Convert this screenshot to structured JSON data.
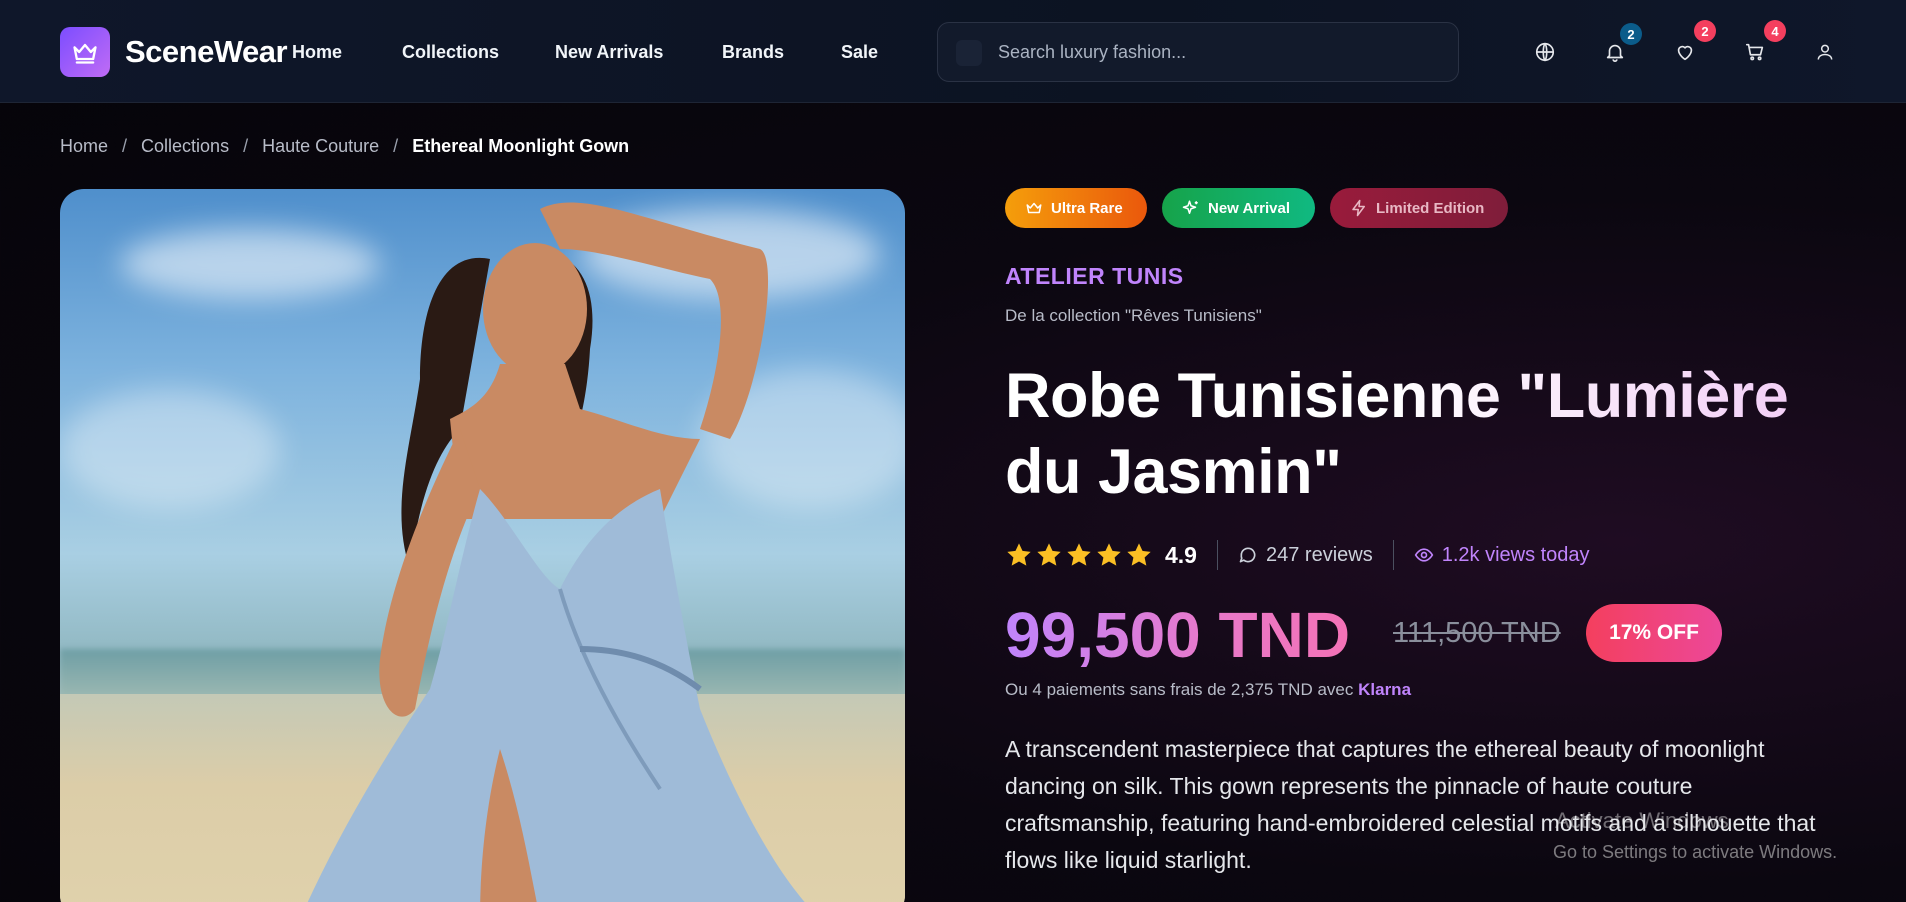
{
  "header": {
    "logo_text": "SceneWear",
    "nav": [
      "Home",
      "Collections",
      "New Arrivals",
      "Brands",
      "Sale"
    ],
    "search_placeholder": "Search luxury fashion...",
    "notifications_count": "2",
    "wishlist_count": "2",
    "cart_count": "4"
  },
  "breadcrumb": [
    "Home",
    "Collections",
    "Haute Couture",
    "Ethereal Moonlight Gown"
  ],
  "badges": [
    "Ultra Rare",
    "New Arrival",
    "Limited Edition"
  ],
  "product": {
    "brand": "ATELIER TUNIS",
    "collection": "De la collection \"Rêves Tunisiens\"",
    "title": "Robe Tunisienne \"Lumière du Jasmin\"",
    "rating": "4.9",
    "stars": 5,
    "reviews": "247 reviews",
    "views": "1.2k views today",
    "price": "99,500 TND",
    "old_price": "111,500 TND",
    "discount": "17% OFF",
    "installments_text": "Ou 4 paiements sans frais de 2,375 TND avec",
    "installments_provider": "Klarna",
    "description": "A transcendent masterpiece that captures the ethereal beauty of moonlight dancing on silk. This gown represents the pinnacle of haute couture craftsmanship, featuring hand-embroidered celestial motifs and a silhouette that flows like liquid starlight."
  },
  "windows_watermark": {
    "title": "Activate Windows",
    "subtitle": "Go to Settings to activate Windows."
  },
  "colors": {
    "accent": "#c084fc",
    "pink": "#ec4899",
    "star": "#fbbf24",
    "ultra_rare": "#f59e0b",
    "new_arrival": "#16a34a",
    "limited_edition": "#9f1d3a"
  }
}
